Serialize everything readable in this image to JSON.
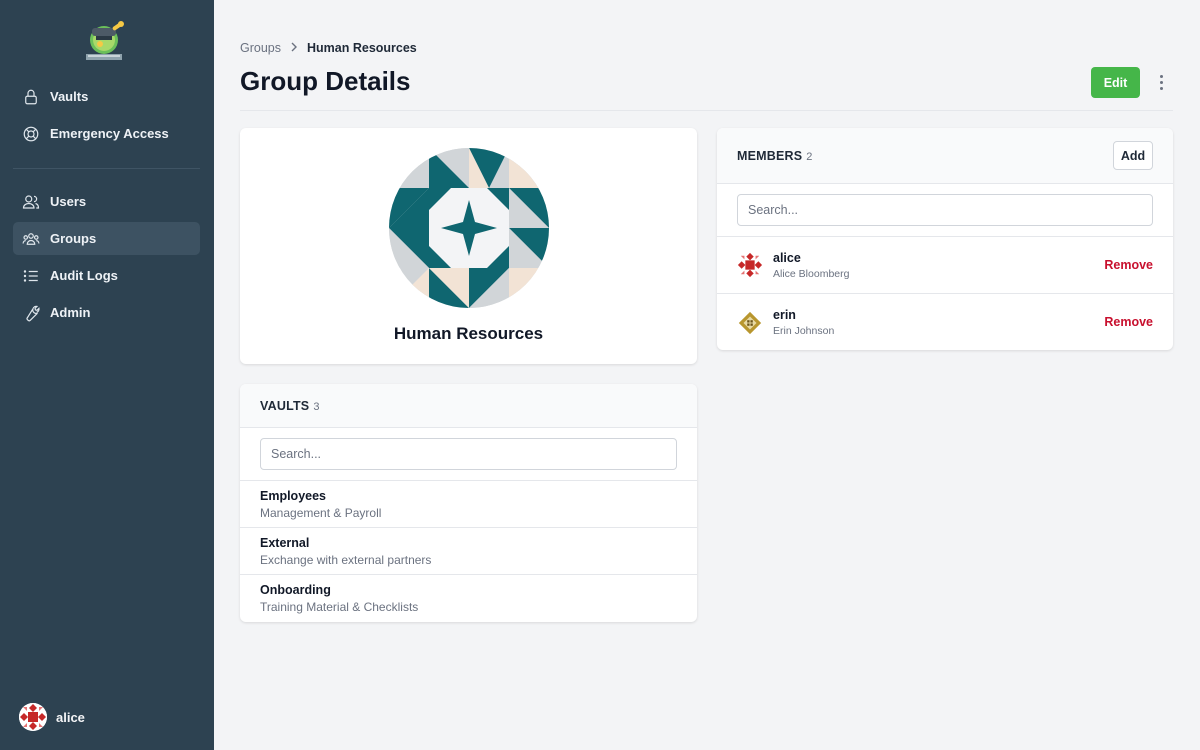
{
  "sidebar": {
    "nav_primary": [
      {
        "label": "Vaults",
        "icon": "lock-icon"
      },
      {
        "label": "Emergency Access",
        "icon": "lifebuoy-icon"
      }
    ],
    "nav_secondary": [
      {
        "label": "Users",
        "icon": "users-icon"
      },
      {
        "label": "Groups",
        "icon": "groups-icon",
        "active": true
      },
      {
        "label": "Audit Logs",
        "icon": "list-icon"
      },
      {
        "label": "Admin",
        "icon": "wrench-icon"
      }
    ],
    "current_user": "alice"
  },
  "breadcrumb": {
    "parent": "Groups",
    "current": "Human Resources"
  },
  "page": {
    "title": "Group Details",
    "edit_label": "Edit"
  },
  "group": {
    "name": "Human Resources"
  },
  "members": {
    "title": "MEMBERS",
    "count": "2",
    "add_label": "Add",
    "search_placeholder": "Search...",
    "items": [
      {
        "username": "alice",
        "full_name": "Alice Bloomberg",
        "action": "Remove"
      },
      {
        "username": "erin",
        "full_name": "Erin Johnson",
        "action": "Remove"
      }
    ]
  },
  "vaults": {
    "title": "VAULTS",
    "count": "3",
    "search_placeholder": "Search...",
    "items": [
      {
        "name": "Employees",
        "description": "Management & Payroll"
      },
      {
        "name": "External",
        "description": "Exchange with external partners"
      },
      {
        "name": "Onboarding",
        "description": "Training Material & Checklists"
      }
    ]
  },
  "colors": {
    "sidebar_bg": "#2d4251",
    "accent_green": "#45b649",
    "danger_red": "#c8102e",
    "group_teal": "#0f6670"
  }
}
